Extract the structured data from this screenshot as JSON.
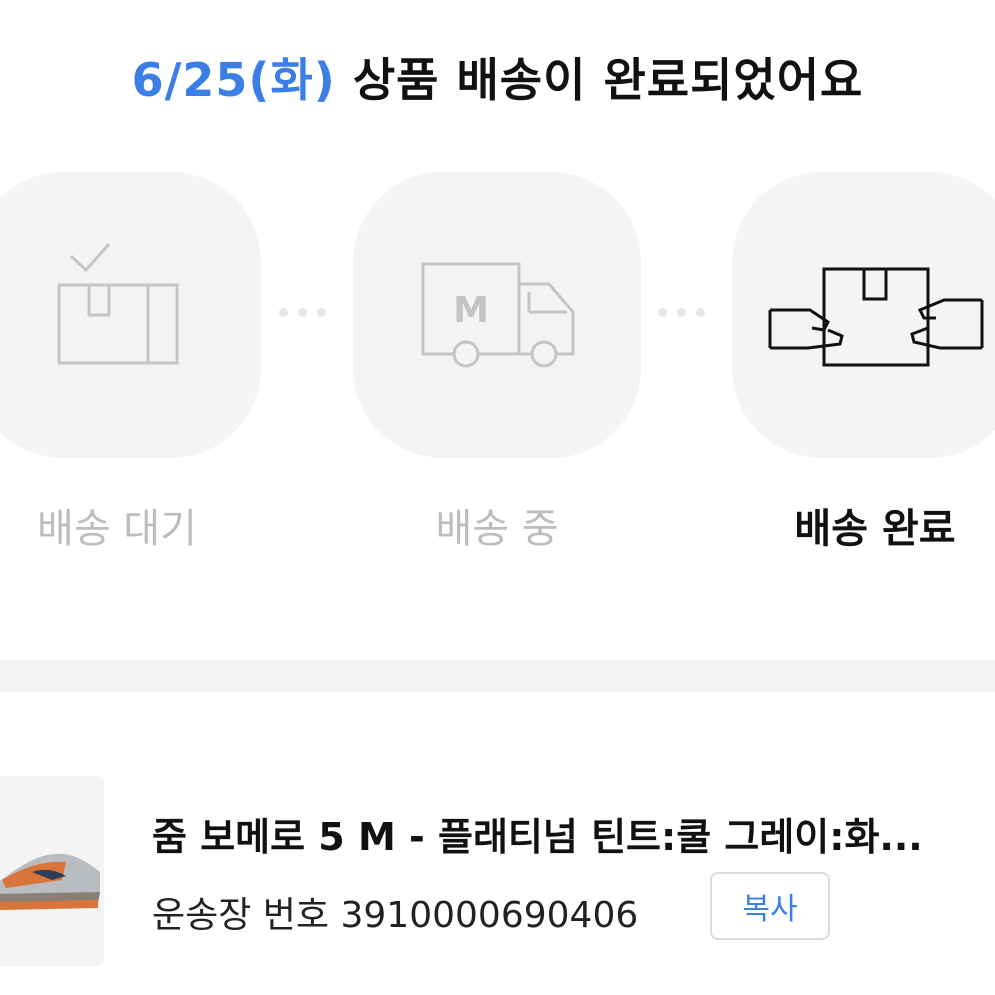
{
  "header": {
    "date": "6/25(화)",
    "message": " 상품 배송이 완료되었어요"
  },
  "steps": [
    {
      "label": "배송 대기",
      "icon": "box-check-icon",
      "active": false
    },
    {
      "label": "배송 중",
      "icon": "delivery-truck-icon",
      "active": false
    },
    {
      "label": "배송 완료",
      "icon": "hands-box-icon",
      "active": true
    }
  ],
  "product": {
    "name": "줌 보메로 5 M - 플래티넘 틴트:쿨 그레이:화...",
    "tracking_label": "운송장 번호",
    "tracking_number": "3910000690406",
    "copy_label": "복사",
    "image_icon": "sneaker-thumbnail"
  },
  "colors": {
    "accent": "#3a7ee6",
    "inactive_text": "#bdbdbd",
    "circle_bg": "#f4f4f4"
  }
}
